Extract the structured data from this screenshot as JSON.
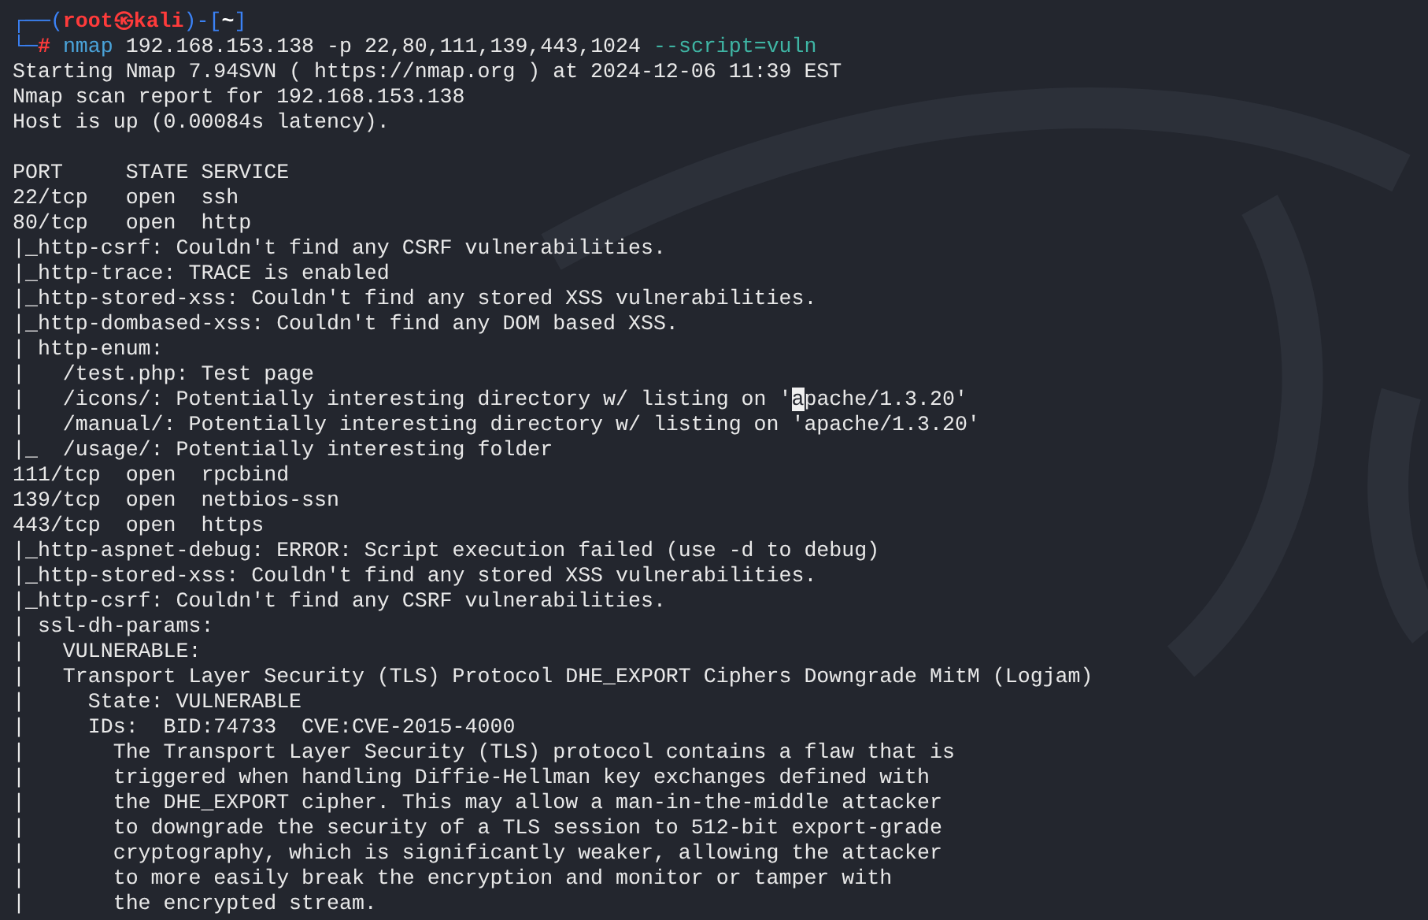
{
  "prompt": {
    "corner_top": "┌──(",
    "user_host": "root㉿kali",
    "mid": ")-[",
    "dir": "~",
    "close": "]",
    "corner_bottom": "└─",
    "symbol": "#",
    "command": "nmap",
    "args": "192.168.153.138 -p 22,80,111,139,443,1024",
    "option": "--script=vuln"
  },
  "output": [
    {
      "kind": "text",
      "text": "Starting Nmap 7.94SVN ( https://nmap.org ) at 2024-12-06 11:39 EST"
    },
    {
      "kind": "text",
      "text": "Nmap scan report for 192.168.153.138"
    },
    {
      "kind": "text",
      "text": "Host is up (0.00084s latency)."
    },
    {
      "kind": "blank"
    },
    {
      "kind": "text",
      "text": "PORT     STATE SERVICE"
    },
    {
      "kind": "text",
      "text": "22/tcp   open  ssh"
    },
    {
      "kind": "text",
      "text": "80/tcp   open  http"
    },
    {
      "kind": "text",
      "text": "|_http-csrf: Couldn't find any CSRF vulnerabilities."
    },
    {
      "kind": "text",
      "text": "|_http-trace: TRACE is enabled"
    },
    {
      "kind": "text",
      "text": "|_http-stored-xss: Couldn't find any stored XSS vulnerabilities."
    },
    {
      "kind": "text",
      "text": "|_http-dombased-xss: Couldn't find any DOM based XSS."
    },
    {
      "kind": "text",
      "text": "| http-enum: "
    },
    {
      "kind": "text",
      "text": "|   /test.php: Test page"
    },
    {
      "kind": "cursor",
      "before": "|   /icons/: Potentially interesting directory w/ listing on '",
      "cursor": "a",
      "after": "pache/1.3.20'"
    },
    {
      "kind": "text",
      "text": "|   /manual/: Potentially interesting directory w/ listing on 'apache/1.3.20'"
    },
    {
      "kind": "text",
      "text": "|_  /usage/: Potentially interesting folder"
    },
    {
      "kind": "text",
      "text": "111/tcp  open  rpcbind"
    },
    {
      "kind": "text",
      "text": "139/tcp  open  netbios-ssn"
    },
    {
      "kind": "text",
      "text": "443/tcp  open  https"
    },
    {
      "kind": "text",
      "text": "|_http-aspnet-debug: ERROR: Script execution failed (use -d to debug)"
    },
    {
      "kind": "text",
      "text": "|_http-stored-xss: Couldn't find any stored XSS vulnerabilities."
    },
    {
      "kind": "text",
      "text": "|_http-csrf: Couldn't find any CSRF vulnerabilities."
    },
    {
      "kind": "text",
      "text": "| ssl-dh-params: "
    },
    {
      "kind": "text",
      "text": "|   VULNERABLE:"
    },
    {
      "kind": "text",
      "text": "|   Transport Layer Security (TLS) Protocol DHE_EXPORT Ciphers Downgrade MitM (Logjam)"
    },
    {
      "kind": "text",
      "text": "|     State: VULNERABLE"
    },
    {
      "kind": "text",
      "text": "|     IDs:  BID:74733  CVE:CVE-2015-4000"
    },
    {
      "kind": "text",
      "text": "|       The Transport Layer Security (TLS) protocol contains a flaw that is"
    },
    {
      "kind": "text",
      "text": "|       triggered when handling Diffie-Hellman key exchanges defined with"
    },
    {
      "kind": "text",
      "text": "|       the DHE_EXPORT cipher. This may allow a man-in-the-middle attacker"
    },
    {
      "kind": "text",
      "text": "|       to downgrade the security of a TLS session to 512-bit export-grade"
    },
    {
      "kind": "text",
      "text": "|       cryptography, which is significantly weaker, allowing the attacker"
    },
    {
      "kind": "text",
      "text": "|       to more easily break the encryption and monitor or tamper with"
    },
    {
      "kind": "text",
      "text": "|       the encrypted stream."
    }
  ]
}
